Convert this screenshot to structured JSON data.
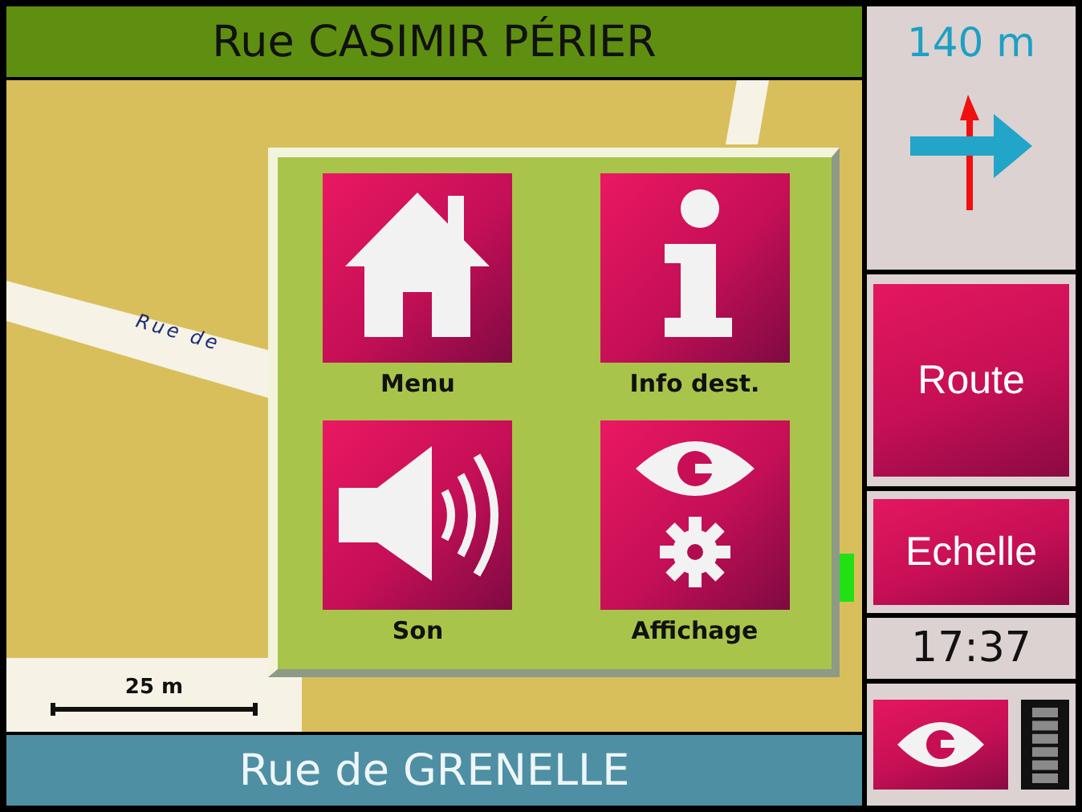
{
  "top_street": "Rue CASIMIR PÉRIER",
  "map": {
    "street_label": "Rue de",
    "scale": "25 m"
  },
  "menu": {
    "items": [
      {
        "kind": "home",
        "label": "Menu"
      },
      {
        "kind": "info",
        "label": "Info dest."
      },
      {
        "kind": "sound",
        "label": "Son"
      },
      {
        "kind": "display",
        "label": "Affichage"
      }
    ]
  },
  "bottom_street": "Rue de GRENELLE",
  "guidance": {
    "distance": "140 m"
  },
  "side_buttons": [
    "Route",
    "Echelle"
  ],
  "clock": "17:37"
}
